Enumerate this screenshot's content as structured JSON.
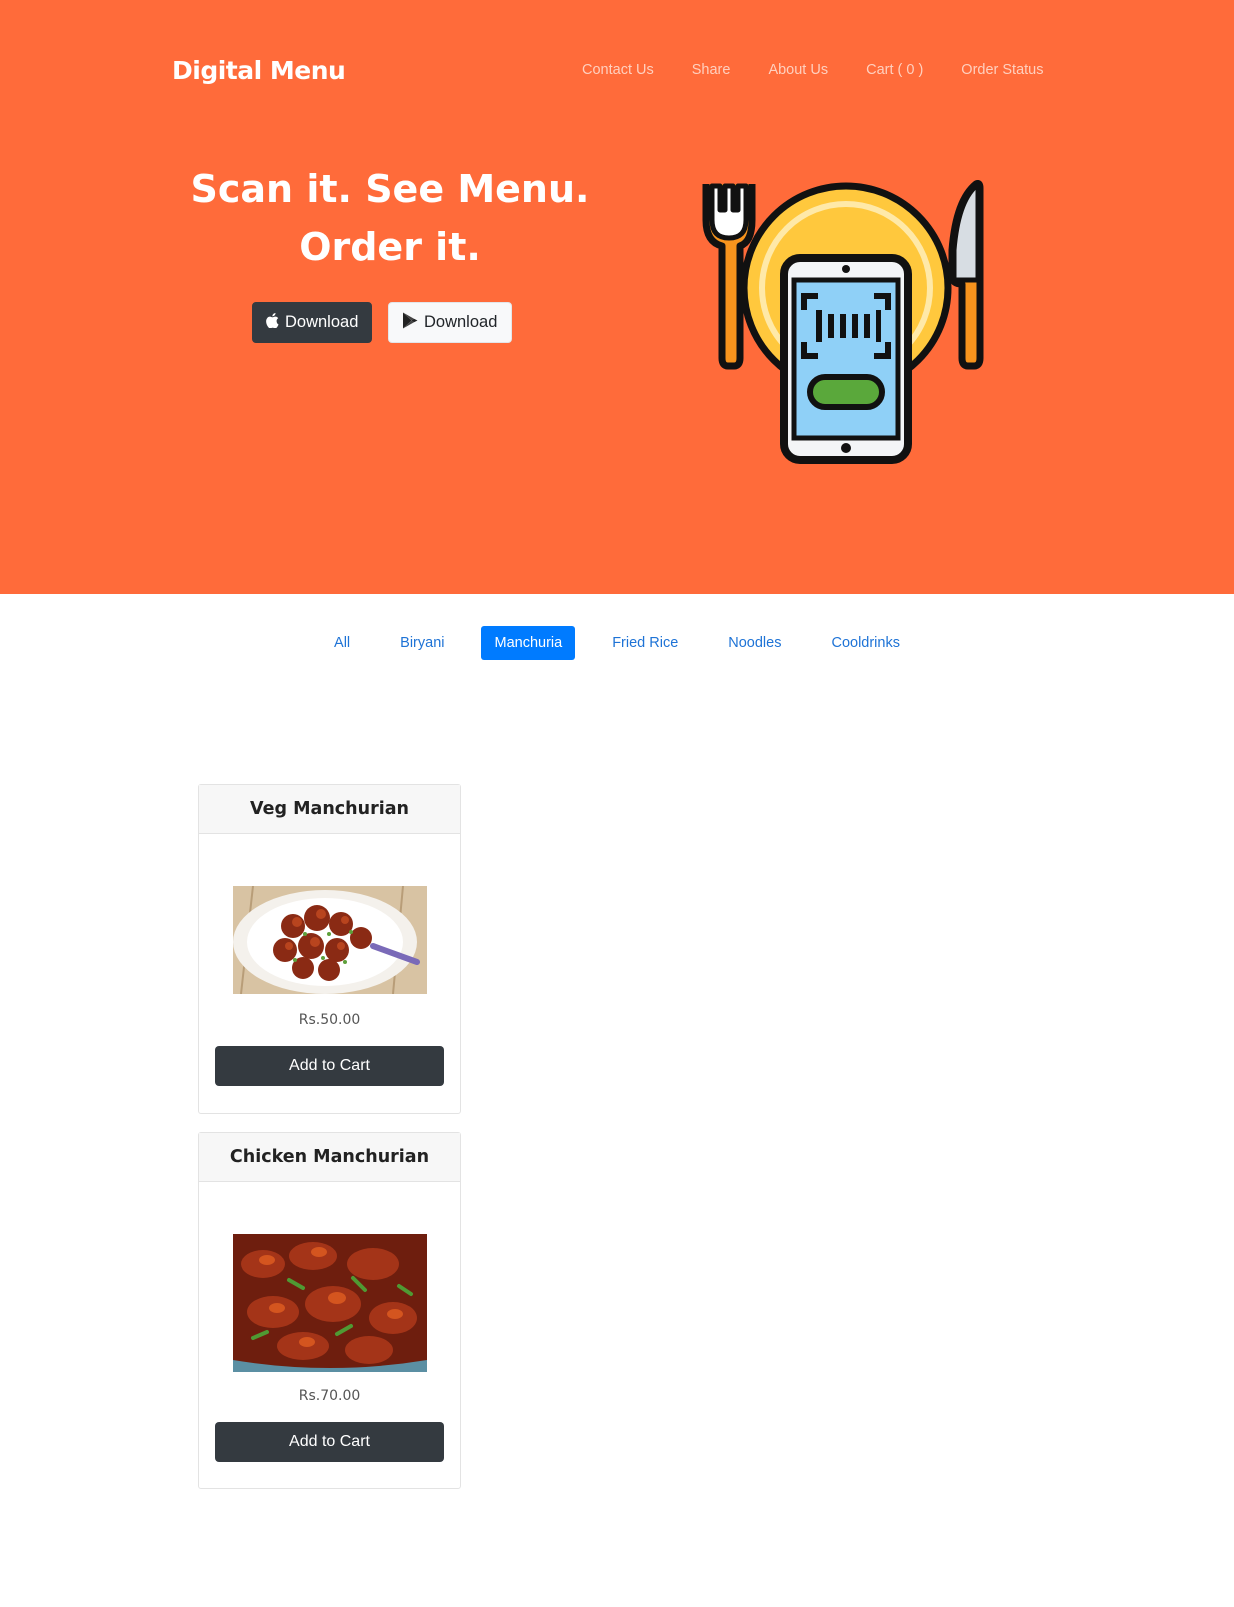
{
  "brand": "Digital Menu",
  "nav": {
    "items": [
      "Contact Us",
      "Share",
      "About Us",
      "Cart ( 0 )",
      "Order Status"
    ]
  },
  "hero": {
    "headline_line1": "Scan it. See Menu.",
    "headline_line2": "Order it.",
    "download_apple_label": "Download",
    "download_play_label": "Download",
    "illustration_icon": "phone-scan-plate-fork-knife-icon"
  },
  "filters": {
    "items": [
      "All",
      "Biryani",
      "Manchuria",
      "Fried Rice",
      "Noodles",
      "Cooldrinks"
    ],
    "active": "Manchuria"
  },
  "products": [
    {
      "name": "Veg Manchurian",
      "price": "Rs.50.00",
      "button": "Add to Cart",
      "image_icon": "veg-manchurian-photo"
    },
    {
      "name": "Chicken Manchurian",
      "price": "Rs.70.00",
      "button": "Add to Cart",
      "image_icon": "chicken-manchurian-photo"
    }
  ],
  "colors": {
    "hero_bg": "#ff6b3a",
    "primary": "#007bff",
    "dark": "#343a40"
  }
}
